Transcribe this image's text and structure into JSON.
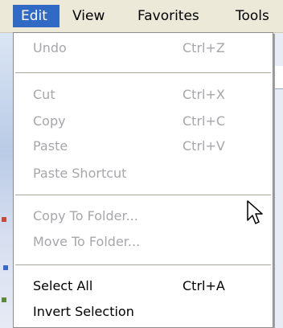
{
  "menubar": {
    "items": [
      {
        "label": "Edit"
      },
      {
        "label": "View"
      },
      {
        "label": "Favorites"
      },
      {
        "label": "Tools"
      }
    ]
  },
  "edit_menu": {
    "items": [
      {
        "label": "Undo",
        "shortcut": "Ctrl+Z",
        "enabled": false
      },
      {
        "label": "Cut",
        "shortcut": "Ctrl+X",
        "enabled": false
      },
      {
        "label": "Copy",
        "shortcut": "Ctrl+C",
        "enabled": false
      },
      {
        "label": "Paste",
        "shortcut": "Ctrl+V",
        "enabled": false
      },
      {
        "label": "Paste Shortcut",
        "shortcut": "",
        "enabled": false
      },
      {
        "label": "Copy To Folder...",
        "shortcut": "",
        "enabled": false
      },
      {
        "label": "Move To Folder...",
        "shortcut": "",
        "enabled": false
      },
      {
        "label": "Select All",
        "shortcut": "Ctrl+A",
        "enabled": true
      },
      {
        "label": "Invert Selection",
        "shortcut": "",
        "enabled": true
      }
    ]
  },
  "colors": {
    "menubar_bg": "#ece9d8",
    "highlight": "#316ac5",
    "disabled_text": "#a7a6aa",
    "enabled_text": "#000000"
  },
  "icons": {
    "cursor": "mouse-pointer-icon"
  }
}
